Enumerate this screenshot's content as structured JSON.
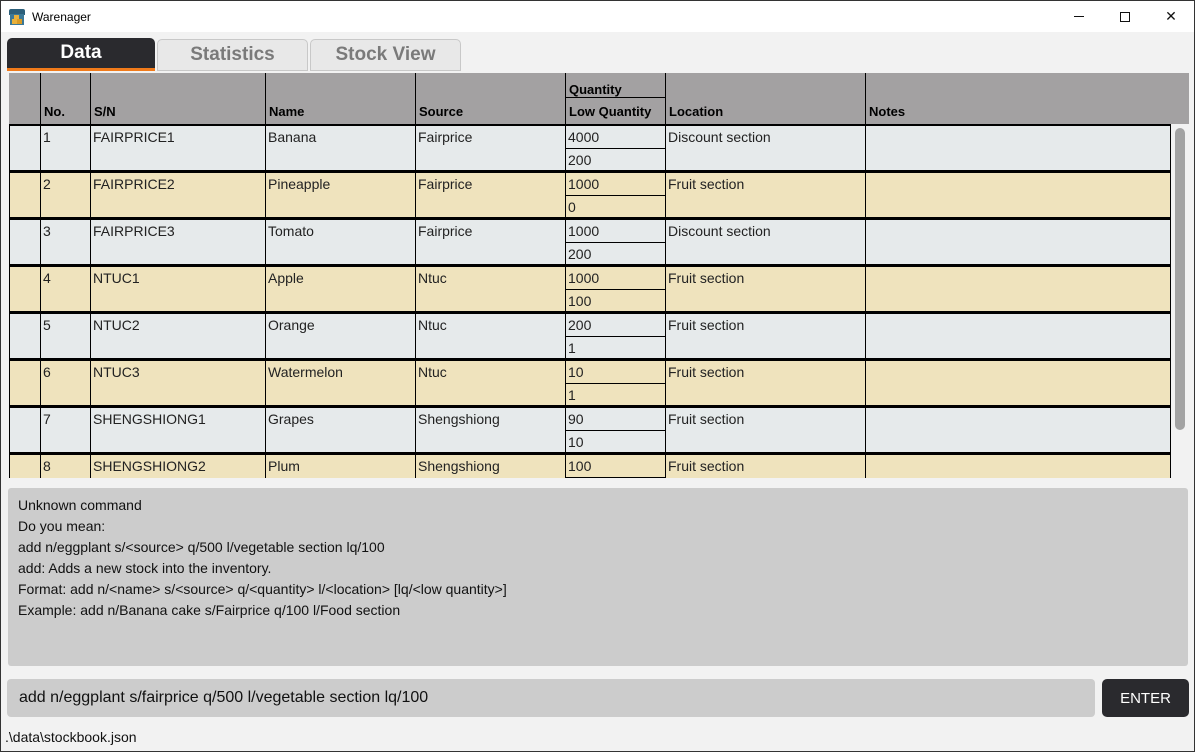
{
  "window": {
    "title": "Warenager",
    "controls": [
      "minimize",
      "maximize",
      "close"
    ]
  },
  "tabs": [
    {
      "label": "Data",
      "active": true
    },
    {
      "label": "Statistics",
      "active": false
    },
    {
      "label": "Stock View",
      "active": false
    }
  ],
  "table": {
    "headers": {
      "no": "No.",
      "sn": "S/N",
      "name": "Name",
      "source": "Source",
      "quantity": "Quantity",
      "low_quantity": "Low Quantity",
      "location": "Location",
      "notes": "Notes"
    },
    "rows": [
      {
        "no": "1",
        "sn": "FAIRPRICE1",
        "name": "Banana",
        "source": "Fairprice",
        "quantity": "4000",
        "low_quantity": "200",
        "location": "Discount section",
        "notes": ""
      },
      {
        "no": "2",
        "sn": "FAIRPRICE2",
        "name": "Pineapple",
        "source": "Fairprice",
        "quantity": "1000",
        "low_quantity": "0",
        "location": "Fruit section",
        "notes": ""
      },
      {
        "no": "3",
        "sn": "FAIRPRICE3",
        "name": "Tomato",
        "source": "Fairprice",
        "quantity": "1000",
        "low_quantity": "200",
        "location": "Discount section",
        "notes": ""
      },
      {
        "no": "4",
        "sn": "NTUC1",
        "name": "Apple",
        "source": "Ntuc",
        "quantity": "1000",
        "low_quantity": "100",
        "location": "Fruit section",
        "notes": ""
      },
      {
        "no": "5",
        "sn": "NTUC2",
        "name": "Orange",
        "source": "Ntuc",
        "quantity": "200",
        "low_quantity": "1",
        "location": "Fruit section",
        "notes": ""
      },
      {
        "no": "6",
        "sn": "NTUC3",
        "name": "Watermelon",
        "source": "Ntuc",
        "quantity": "10",
        "low_quantity": "1",
        "location": "Fruit section",
        "notes": ""
      },
      {
        "no": "7",
        "sn": "SHENGSHIONG1",
        "name": "Grapes",
        "source": "Shengshiong",
        "quantity": "90",
        "low_quantity": "10",
        "location": "Fruit section",
        "notes": ""
      },
      {
        "no": "8",
        "sn": "SHENGSHIONG2",
        "name": "Plum",
        "source": "Shengshiong",
        "quantity": "100",
        "low_quantity": "",
        "location": "Fruit section",
        "notes": ""
      }
    ]
  },
  "result": {
    "lines": [
      "Unknown command",
      "Do you mean:",
      "add n/eggplant s/<source> q/500 l/vegetable section lq/100",
      "add: Adds a new stock into the inventory.",
      "Format: add n/<name> s/<source> q/<quantity> l/<location> [lq/<low quantity>]",
      "Example: add n/Banana cake s/Fairprice q/100 l/Food section"
    ]
  },
  "command": {
    "value": "add n/eggplant s/fairprice q/500 l/vegetable section lq/100",
    "enter_label": "ENTER"
  },
  "status": {
    "file_path": ".\\data\\stockbook.json"
  },
  "colors": {
    "accent": "#f07a1a",
    "dark": "#2a2a2e",
    "row_light": "#e6eaeb",
    "row_tan": "#efe3bd",
    "header_gray": "#a3a1a2"
  }
}
